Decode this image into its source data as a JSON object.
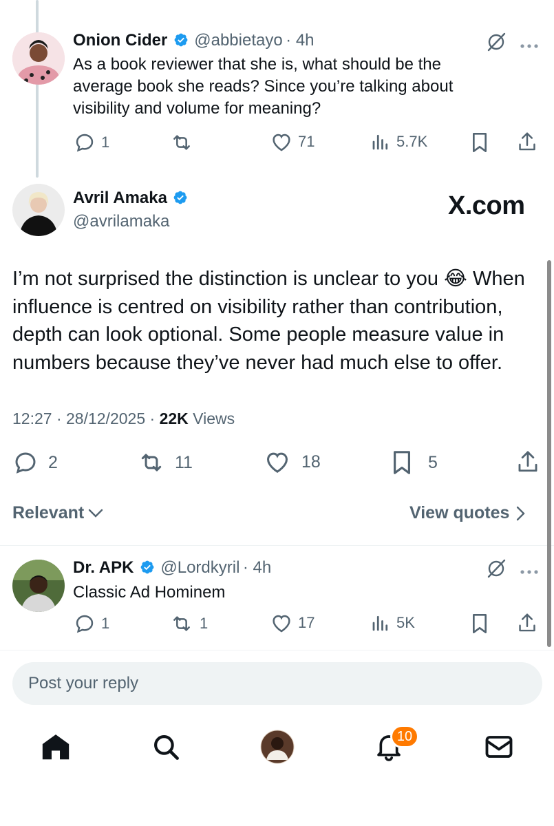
{
  "reply1": {
    "name": "Onion Cider",
    "handle": "@abbietayo",
    "time": "· 4h",
    "text": "As a book reviewer that she is, what should be the average book she reads? Since you’re talking about visibility and volume for meaning?",
    "replies": "1",
    "reposts": "",
    "likes": "71",
    "views": "5.7K"
  },
  "main": {
    "name": "Avril Amaka",
    "handle": "@avrilamaka",
    "watermark": "X.com",
    "text": "I’m not surprised the distinction is unclear to you 😂 When influence is centred on visibility rather than contribution, depth can look optional. Some people measure value in numbers because they’ve never had much else to offer.",
    "timestamp": "12:27 · 28/12/2025 · ",
    "views_count": "22K",
    "views_label": " Views",
    "replies": "2",
    "reposts": "11",
    "likes": "18",
    "bookmarks": "5"
  },
  "sort": {
    "label": "Relevant",
    "quotes": "View quotes"
  },
  "reply2": {
    "name": "Dr. APK",
    "handle": "@Lordkyril",
    "time": "· 4h",
    "text": "Classic Ad Hominem",
    "replies": "1",
    "reposts": "1",
    "likes": "17",
    "views": "5K"
  },
  "composer": {
    "placeholder": "Post your reply"
  },
  "nav": {
    "notifications_badge": "10"
  },
  "colors": {
    "verified": "#1d9bf0",
    "badge": "#ff7a00",
    "muted_text": "#536471"
  }
}
